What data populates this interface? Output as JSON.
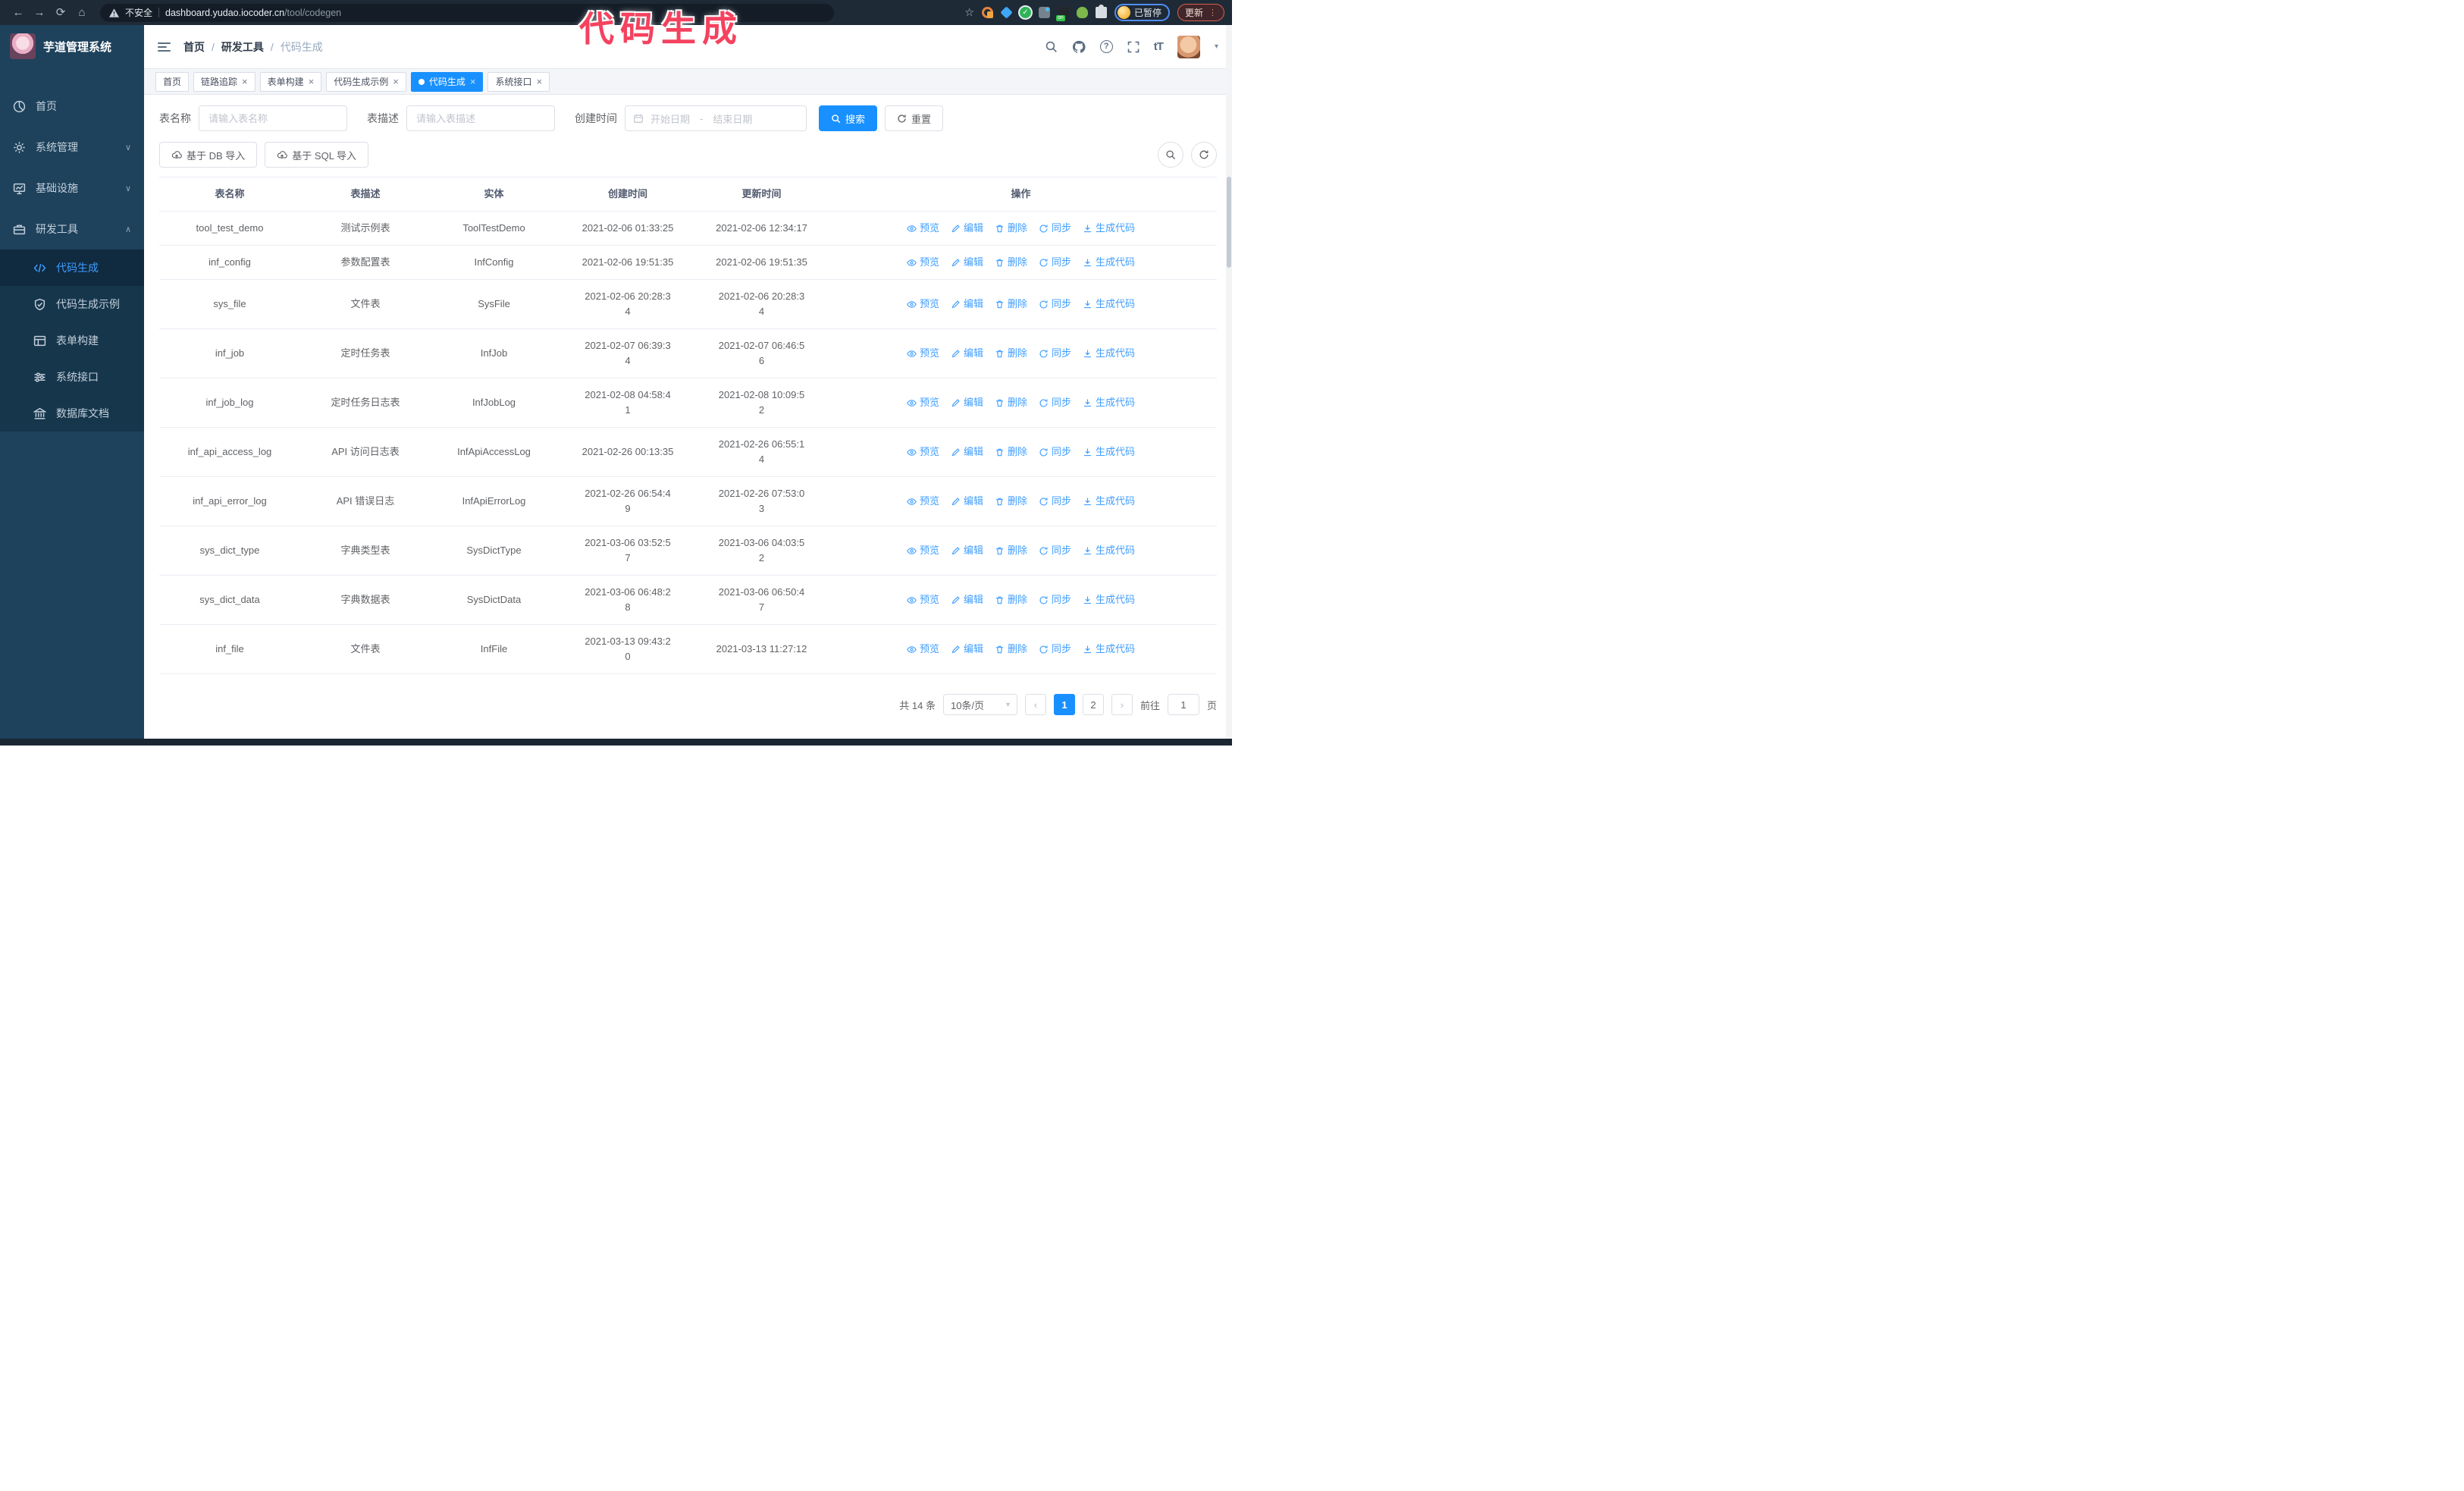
{
  "browser": {
    "security_label": "不安全",
    "url_host": "dashboard.yudao.iocoder.cn",
    "url_path": "/tool/codegen",
    "profile_badge": "已暂停",
    "update_label": "更新"
  },
  "overlay": {
    "title": "代码生成",
    "color": "#f4425f"
  },
  "sidebar": {
    "logo_title": "芋道管理系统",
    "items": [
      {
        "label": "首页",
        "icon": "dashboard-icon"
      },
      {
        "label": "系统管理",
        "icon": "gear-icon",
        "chevron": "down"
      },
      {
        "label": "基础设施",
        "icon": "monitor-icon",
        "chevron": "down"
      },
      {
        "label": "研发工具",
        "icon": "toolbox-icon",
        "chevron": "up"
      }
    ],
    "submenu": [
      {
        "label": "代码生成",
        "icon": "code-icon",
        "active": true
      },
      {
        "label": "代码生成示例",
        "icon": "shield-check-icon",
        "active": false
      },
      {
        "label": "表单构建",
        "icon": "form-icon",
        "active": false
      },
      {
        "label": "系统接口",
        "icon": "sliders-icon",
        "active": false
      },
      {
        "label": "数据库文档",
        "icon": "database-icon",
        "active": false
      }
    ]
  },
  "header": {
    "breadcrumb": [
      "首页",
      "研发工具",
      "代码生成"
    ],
    "breadcrumb_separator": "/"
  },
  "tabs": [
    {
      "label": "首页",
      "closable": false,
      "active": false
    },
    {
      "label": "链路追踪",
      "closable": true,
      "active": false
    },
    {
      "label": "表单构建",
      "closable": true,
      "active": false
    },
    {
      "label": "代码生成示例",
      "closable": true,
      "active": false
    },
    {
      "label": "代码生成",
      "closable": true,
      "active": true
    },
    {
      "label": "系统接口",
      "closable": true,
      "active": false
    }
  ],
  "filters": {
    "table_name_label": "表名称",
    "table_name_placeholder": "请输入表名称",
    "table_desc_label": "表描述",
    "table_desc_placeholder": "请输入表描述",
    "create_time_label": "创建时间",
    "date_start_placeholder": "开始日期",
    "date_separator": "-",
    "date_end_placeholder": "结束日期",
    "search_label": "搜索",
    "reset_label": "重置"
  },
  "toolbar": {
    "import_db_label": "基于 DB 导入",
    "import_sql_label": "基于 SQL 导入"
  },
  "table": {
    "columns": [
      "表名称",
      "表描述",
      "实体",
      "创建时间",
      "更新时间",
      "操作"
    ],
    "row_actions": [
      "预览",
      "编辑",
      "删除",
      "同步",
      "生成代码"
    ],
    "rows": [
      {
        "name": "tool_test_demo",
        "desc": "测试示例表",
        "entity": "ToolTestDemo",
        "created": "2021-02-06 01:33:25",
        "updated": "2021-02-06 12:34:17"
      },
      {
        "name": "inf_config",
        "desc": "参数配置表",
        "entity": "InfConfig",
        "created": "2021-02-06 19:51:35",
        "updated": "2021-02-06 19:51:35"
      },
      {
        "name": "sys_file",
        "desc": "文件表",
        "entity": "SysFile",
        "created": "2021-02-06 20:28:3\n4",
        "updated": "2021-02-06 20:28:3\n4"
      },
      {
        "name": "inf_job",
        "desc": "定时任务表",
        "entity": "InfJob",
        "created": "2021-02-07 06:39:3\n4",
        "updated": "2021-02-07 06:46:5\n6"
      },
      {
        "name": "inf_job_log",
        "desc": "定时任务日志表",
        "entity": "InfJobLog",
        "created": "2021-02-08 04:58:4\n1",
        "updated": "2021-02-08 10:09:5\n2"
      },
      {
        "name": "inf_api_access_log",
        "desc": "API 访问日志表",
        "entity": "InfApiAccessLog",
        "created": "2021-02-26 00:13:35",
        "updated": "2021-02-26 06:55:1\n4"
      },
      {
        "name": "inf_api_error_log",
        "desc": "API 错误日志",
        "entity": "InfApiErrorLog",
        "created": "2021-02-26 06:54:4\n9",
        "updated": "2021-02-26 07:53:0\n3"
      },
      {
        "name": "sys_dict_type",
        "desc": "字典类型表",
        "entity": "SysDictType",
        "created": "2021-03-06 03:52:5\n7",
        "updated": "2021-03-06 04:03:5\n2"
      },
      {
        "name": "sys_dict_data",
        "desc": "字典数据表",
        "entity": "SysDictData",
        "created": "2021-03-06 06:48:2\n8",
        "updated": "2021-03-06 06:50:4\n7"
      },
      {
        "name": "inf_file",
        "desc": "文件表",
        "entity": "InfFile",
        "created": "2021-03-13 09:43:2\n0",
        "updated": "2021-03-13 11:27:12"
      }
    ]
  },
  "pagination": {
    "total_label": "共 14 条",
    "page_size": "10条/页",
    "pages": [
      "1",
      "2"
    ],
    "active_page": "1",
    "goto_label": "前往",
    "goto_value": "1",
    "page_suffix": "页"
  },
  "icons": {
    "browser": [
      "back-icon",
      "forward-icon",
      "reload-icon",
      "home-icon",
      "warning-icon",
      "star-icon",
      "kebab-menu-icon"
    ],
    "header": [
      "search-icon",
      "github-icon",
      "help-icon",
      "fullscreen-icon",
      "font-size-icon",
      "chevron-down-icon"
    ],
    "row_actions": [
      "eye-icon",
      "edit-icon",
      "delete-icon",
      "sync-icon",
      "download-icon"
    ]
  },
  "colors": {
    "accent_blue": "#409EFF",
    "active_tab_blue": "#1890ff",
    "sidebar_bg": "#1e425c",
    "submenu_bg": "#16364c",
    "browser_bar_bg": "#1f2a37",
    "overlay_pink": "#f4425f"
  }
}
